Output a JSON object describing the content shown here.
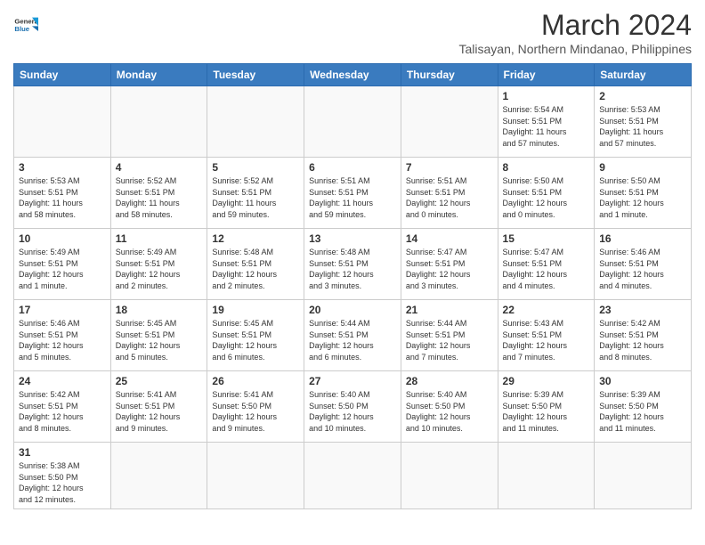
{
  "header": {
    "logo_text_general": "General",
    "logo_text_blue": "Blue",
    "month_title": "March 2024",
    "location": "Talisayan, Northern Mindanao, Philippines"
  },
  "days_of_week": [
    "Sunday",
    "Monday",
    "Tuesday",
    "Wednesday",
    "Thursday",
    "Friday",
    "Saturday"
  ],
  "weeks": [
    [
      {
        "day": "",
        "info": "",
        "empty": true
      },
      {
        "day": "",
        "info": "",
        "empty": true
      },
      {
        "day": "",
        "info": "",
        "empty": true
      },
      {
        "day": "",
        "info": "",
        "empty": true
      },
      {
        "day": "",
        "info": "",
        "empty": true
      },
      {
        "day": "1",
        "info": "Sunrise: 5:54 AM\nSunset: 5:51 PM\nDaylight: 11 hours\nand 57 minutes."
      },
      {
        "day": "2",
        "info": "Sunrise: 5:53 AM\nSunset: 5:51 PM\nDaylight: 11 hours\nand 57 minutes."
      }
    ],
    [
      {
        "day": "3",
        "info": "Sunrise: 5:53 AM\nSunset: 5:51 PM\nDaylight: 11 hours\nand 58 minutes."
      },
      {
        "day": "4",
        "info": "Sunrise: 5:52 AM\nSunset: 5:51 PM\nDaylight: 11 hours\nand 58 minutes."
      },
      {
        "day": "5",
        "info": "Sunrise: 5:52 AM\nSunset: 5:51 PM\nDaylight: 11 hours\nand 59 minutes."
      },
      {
        "day": "6",
        "info": "Sunrise: 5:51 AM\nSunset: 5:51 PM\nDaylight: 11 hours\nand 59 minutes."
      },
      {
        "day": "7",
        "info": "Sunrise: 5:51 AM\nSunset: 5:51 PM\nDaylight: 12 hours\nand 0 minutes."
      },
      {
        "day": "8",
        "info": "Sunrise: 5:50 AM\nSunset: 5:51 PM\nDaylight: 12 hours\nand 0 minutes."
      },
      {
        "day": "9",
        "info": "Sunrise: 5:50 AM\nSunset: 5:51 PM\nDaylight: 12 hours\nand 1 minute."
      }
    ],
    [
      {
        "day": "10",
        "info": "Sunrise: 5:49 AM\nSunset: 5:51 PM\nDaylight: 12 hours\nand 1 minute."
      },
      {
        "day": "11",
        "info": "Sunrise: 5:49 AM\nSunset: 5:51 PM\nDaylight: 12 hours\nand 2 minutes."
      },
      {
        "day": "12",
        "info": "Sunrise: 5:48 AM\nSunset: 5:51 PM\nDaylight: 12 hours\nand 2 minutes."
      },
      {
        "day": "13",
        "info": "Sunrise: 5:48 AM\nSunset: 5:51 PM\nDaylight: 12 hours\nand 3 minutes."
      },
      {
        "day": "14",
        "info": "Sunrise: 5:47 AM\nSunset: 5:51 PM\nDaylight: 12 hours\nand 3 minutes."
      },
      {
        "day": "15",
        "info": "Sunrise: 5:47 AM\nSunset: 5:51 PM\nDaylight: 12 hours\nand 4 minutes."
      },
      {
        "day": "16",
        "info": "Sunrise: 5:46 AM\nSunset: 5:51 PM\nDaylight: 12 hours\nand 4 minutes."
      }
    ],
    [
      {
        "day": "17",
        "info": "Sunrise: 5:46 AM\nSunset: 5:51 PM\nDaylight: 12 hours\nand 5 minutes."
      },
      {
        "day": "18",
        "info": "Sunrise: 5:45 AM\nSunset: 5:51 PM\nDaylight: 12 hours\nand 5 minutes."
      },
      {
        "day": "19",
        "info": "Sunrise: 5:45 AM\nSunset: 5:51 PM\nDaylight: 12 hours\nand 6 minutes."
      },
      {
        "day": "20",
        "info": "Sunrise: 5:44 AM\nSunset: 5:51 PM\nDaylight: 12 hours\nand 6 minutes."
      },
      {
        "day": "21",
        "info": "Sunrise: 5:44 AM\nSunset: 5:51 PM\nDaylight: 12 hours\nand 7 minutes."
      },
      {
        "day": "22",
        "info": "Sunrise: 5:43 AM\nSunset: 5:51 PM\nDaylight: 12 hours\nand 7 minutes."
      },
      {
        "day": "23",
        "info": "Sunrise: 5:42 AM\nSunset: 5:51 PM\nDaylight: 12 hours\nand 8 minutes."
      }
    ],
    [
      {
        "day": "24",
        "info": "Sunrise: 5:42 AM\nSunset: 5:51 PM\nDaylight: 12 hours\nand 8 minutes."
      },
      {
        "day": "25",
        "info": "Sunrise: 5:41 AM\nSunset: 5:51 PM\nDaylight: 12 hours\nand 9 minutes."
      },
      {
        "day": "26",
        "info": "Sunrise: 5:41 AM\nSunset: 5:50 PM\nDaylight: 12 hours\nand 9 minutes."
      },
      {
        "day": "27",
        "info": "Sunrise: 5:40 AM\nSunset: 5:50 PM\nDaylight: 12 hours\nand 10 minutes."
      },
      {
        "day": "28",
        "info": "Sunrise: 5:40 AM\nSunset: 5:50 PM\nDaylight: 12 hours\nand 10 minutes."
      },
      {
        "day": "29",
        "info": "Sunrise: 5:39 AM\nSunset: 5:50 PM\nDaylight: 12 hours\nand 11 minutes."
      },
      {
        "day": "30",
        "info": "Sunrise: 5:39 AM\nSunset: 5:50 PM\nDaylight: 12 hours\nand 11 minutes."
      }
    ],
    [
      {
        "day": "31",
        "info": "Sunrise: 5:38 AM\nSunset: 5:50 PM\nDaylight: 12 hours\nand 12 minutes."
      },
      {
        "day": "",
        "info": "",
        "empty": true
      },
      {
        "day": "",
        "info": "",
        "empty": true
      },
      {
        "day": "",
        "info": "",
        "empty": true
      },
      {
        "day": "",
        "info": "",
        "empty": true
      },
      {
        "day": "",
        "info": "",
        "empty": true
      },
      {
        "day": "",
        "info": "",
        "empty": true
      }
    ]
  ]
}
